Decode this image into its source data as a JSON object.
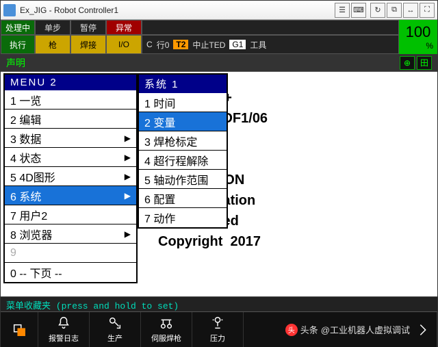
{
  "title": "Ex_JIG - Robot Controller1",
  "toolstrip": {
    "r1c1": "处理中",
    "r1c2": "单步",
    "r1c3": "暂停",
    "r1c4": "异常",
    "r2c1": "执行",
    "r2c2": "枪",
    "r2c3": "焊接",
    "r2c4": "I/O",
    "status_c": "C",
    "status_line": "行0",
    "status_t2": "T2",
    "status_stop": "中止TED",
    "status_g1": "G1",
    "status_tool": "工具",
    "pct_num": "100",
    "pct_sym": "%"
  },
  "section": {
    "label": "声明"
  },
  "bg": {
    "l1": "          Tool+",
    "l2": "               7DF1/06",
    "l3": "",
    "l4": "",
    "l5": "    PORATION",
    "l6": "     Corporation",
    "l7": "     Reserved",
    "l8": "Copyright  2017"
  },
  "menu1": {
    "title": "MENU  2",
    "items": [
      {
        "n": "1",
        "t": "一览",
        "arrow": false
      },
      {
        "n": "2",
        "t": "编辑",
        "arrow": false
      },
      {
        "n": "3",
        "t": "数据",
        "arrow": true
      },
      {
        "n": "4",
        "t": "状态",
        "arrow": true
      },
      {
        "n": "5",
        "t": "4D图形",
        "arrow": true
      },
      {
        "n": "6",
        "t": "系统",
        "arrow": true,
        "sel": true
      },
      {
        "n": "7",
        "t": "用户2",
        "arrow": false
      },
      {
        "n": "8",
        "t": "浏览器",
        "arrow": true
      },
      {
        "n": "9",
        "t": "",
        "arrow": false,
        "dis": true
      },
      {
        "n": "0",
        "t": "-- 下页 --",
        "arrow": false
      }
    ]
  },
  "menu2": {
    "title": "系统  1",
    "items": [
      {
        "n": "1",
        "t": "时间"
      },
      {
        "n": "2",
        "t": "变量",
        "sel": true
      },
      {
        "n": "3",
        "t": "焊枪标定"
      },
      {
        "n": "4",
        "t": "超行程解除"
      },
      {
        "n": "5",
        "t": "轴动作范围"
      },
      {
        "n": "6",
        "t": "配置"
      },
      {
        "n": "7",
        "t": "动作"
      }
    ]
  },
  "favbar": "菜单收藏夹 (press and hold to set)",
  "bottom": {
    "b2": "报警日志",
    "b3": "生产",
    "b4": "伺服焊枪",
    "b5": "压力"
  },
  "watermark": {
    "a": "头条",
    "b": "@工业机器人虚拟调试"
  }
}
